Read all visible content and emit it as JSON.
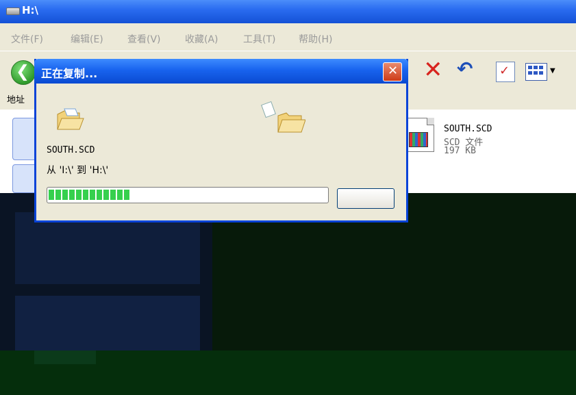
{
  "window": {
    "title": "H:\\"
  },
  "menu": [
    "文件(F)",
    "编辑(E)",
    "查看(V)",
    "收藏(A)",
    "工具(T)",
    "帮助(H)"
  ],
  "address": {
    "label": "地址"
  },
  "file": {
    "name": "SOUTH.SCD",
    "type": "SCD 文件",
    "size": "197 KB"
  },
  "dialog": {
    "title": "正在复制...",
    "filename": "SOUTH.SCD",
    "from_to": "从 'I:\\' 到 'H:\\'",
    "progress": 0.29
  },
  "colors": {
    "titlebar": "#1e5eea",
    "dialog_title": "#0a4ad1",
    "close": "#cf3b17",
    "progress": "#36d04d"
  }
}
